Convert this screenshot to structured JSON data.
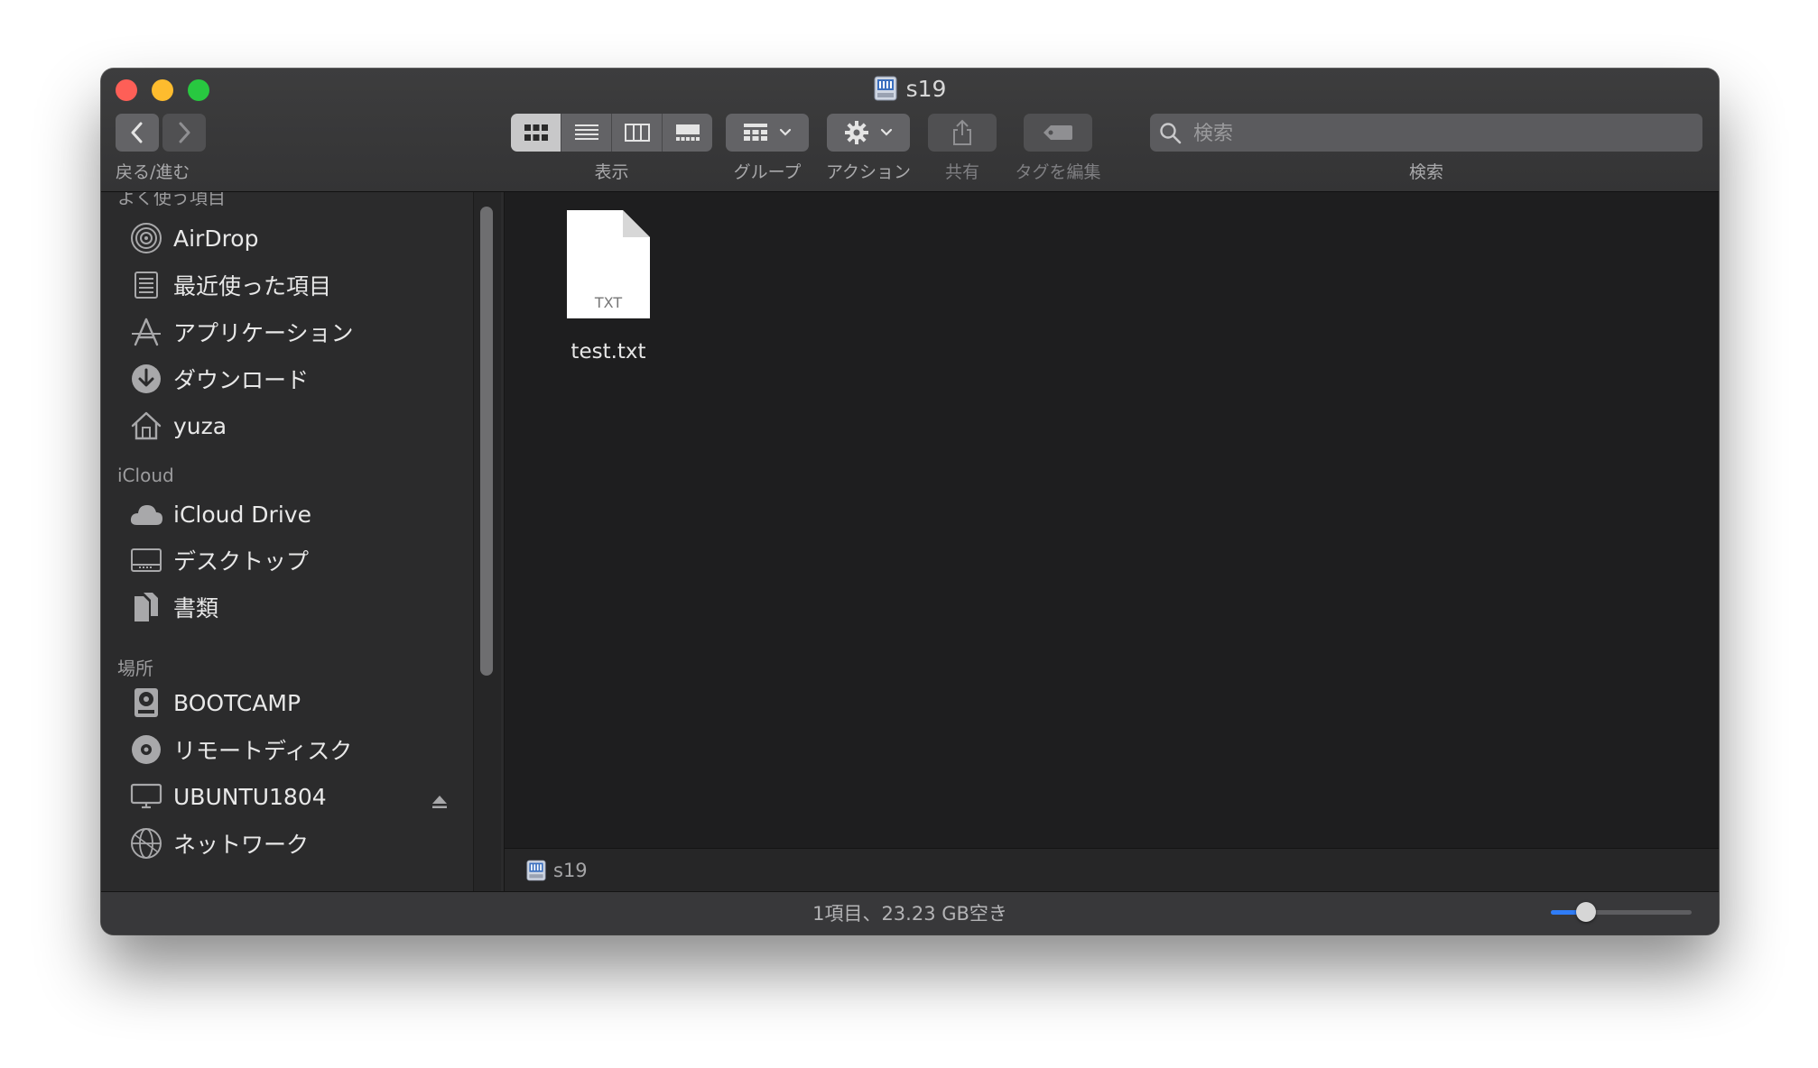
{
  "window": {
    "title": "s19"
  },
  "toolbar": {
    "back_forward_label": "戻る/進む",
    "view_label": "表示",
    "group_label": "グループ",
    "action_label": "アクション",
    "share_label": "共有",
    "tags_label": "タグを編集",
    "search_label": "検索",
    "search_placeholder": "検索",
    "active_view": "icon"
  },
  "sidebar": {
    "favorites_header": "よく使う項目",
    "favorites": [
      {
        "label": "AirDrop",
        "icon": "airdrop-icon"
      },
      {
        "label": "最近使った項目",
        "icon": "recents-icon"
      },
      {
        "label": "アプリケーション",
        "icon": "applications-icon"
      },
      {
        "label": "ダウンロード",
        "icon": "downloads-icon"
      },
      {
        "label": "yuza",
        "icon": "home-icon"
      }
    ],
    "icloud_header": "iCloud",
    "icloud": [
      {
        "label": "iCloud Drive",
        "icon": "cloud-icon"
      },
      {
        "label": "デスクトップ",
        "icon": "desktop-icon"
      },
      {
        "label": "書類",
        "icon": "documents-icon"
      }
    ],
    "locations_header": "場所",
    "locations": [
      {
        "label": "BOOTCAMP",
        "icon": "drive-icon"
      },
      {
        "label": "リモートディスク",
        "icon": "disc-icon"
      },
      {
        "label": "UBUNTU1804",
        "icon": "display-icon"
      },
      {
        "label": "ネットワーク",
        "icon": "network-icon"
      }
    ]
  },
  "content": {
    "files": [
      {
        "name": "test.txt",
        "type_badge": "TXT"
      }
    ]
  },
  "pathbar": {
    "current": "s19"
  },
  "statusbar": {
    "text": "1項目、23.23 GB空き",
    "icon_size_level": 0.25
  },
  "colors": {
    "close": "#fe5f57",
    "minimize": "#febc2e",
    "maximize": "#28c840",
    "accent": "#2f7cf6"
  }
}
